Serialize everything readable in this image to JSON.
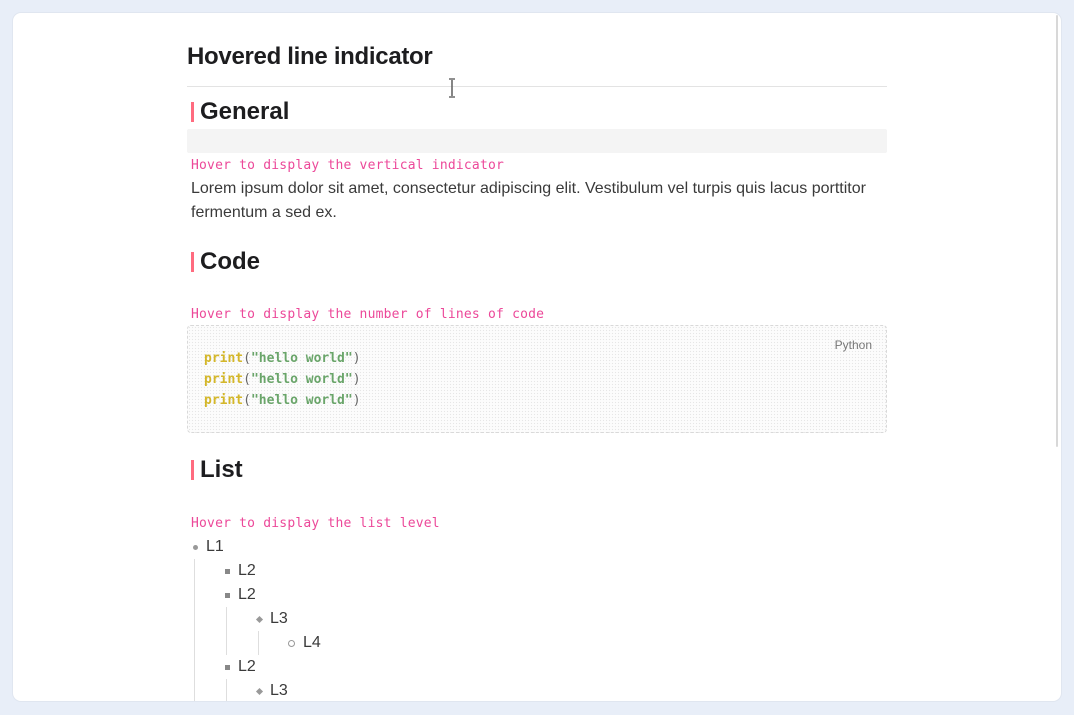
{
  "page": {
    "title": "Hovered line indicator"
  },
  "sections": {
    "general": {
      "heading": "General",
      "hint": "Hover to display the vertical indicator",
      "paragraph": "Lorem ipsum dolor sit amet, consectetur adipiscing elit. Vestibulum vel turpis quis lacus porttitor fermentum a sed ex."
    },
    "code": {
      "heading": "Code",
      "hint": "Hover to display the number of lines of code",
      "language": "Python",
      "lines": [
        {
          "fn": "print",
          "open": "(",
          "str": "\"hello world\"",
          "close": ")"
        },
        {
          "fn": "print",
          "open": "(",
          "str": "\"hello world\"",
          "close": ")"
        },
        {
          "fn": "print",
          "open": "(",
          "str": "\"hello world\"",
          "close": ")"
        }
      ]
    },
    "list": {
      "heading": "List",
      "hint": "Hover to display the list level",
      "items": [
        "L1",
        "L2",
        "L2",
        "L3",
        "L4",
        "L2",
        "L3"
      ]
    }
  },
  "icons": {
    "cursor": "text-cursor-icon"
  },
  "colors": {
    "accent": "#ff6b7f",
    "hint": "#ec4899",
    "keyword": "#d4b72a",
    "string": "#6aa56a"
  }
}
